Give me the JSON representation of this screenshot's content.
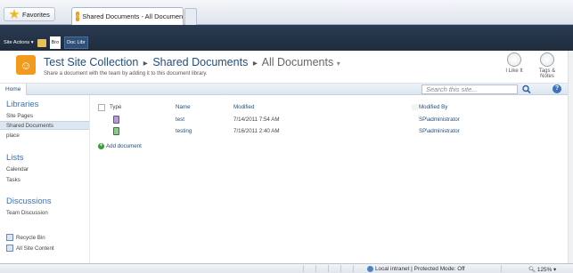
{
  "browser": {
    "favorites_label": "Favorites",
    "tab_title": "Shared Documents - All Documents"
  },
  "ribbon": {
    "site_actions": "Site Actions ▾",
    "browse_tab": "Bro",
    "library_tab": "Doc Libr"
  },
  "title_area": {
    "site_name": "Test Site Collection",
    "list_name": "Shared Documents",
    "view_name": "All Documents",
    "view_dropdown": "▾",
    "description": "Share a document with the team by adding it to this document library.",
    "i_like_it": "I Like It",
    "tags_notes": "Tags & Notes"
  },
  "topnav": {
    "home": "Home",
    "search_placeholder": "Search this site...",
    "help": "?"
  },
  "leftnav": {
    "libraries_heading": "Libraries",
    "libraries": [
      "Site Pages",
      "Shared Documents",
      "place"
    ],
    "lists_heading": "Lists",
    "lists": [
      "Calendar",
      "Tasks"
    ],
    "discussions_heading": "Discussions",
    "discussions": [
      "Team Discussion"
    ],
    "recycle_bin": "Recycle Bin",
    "all_site_content": "All Site Content"
  },
  "list": {
    "columns": [
      "Type",
      "Name",
      "Modified",
      "Modified By"
    ],
    "rows": [
      {
        "name": "test",
        "modified": "7/14/2011 7:54 AM",
        "modified_by": "SP\\administrator",
        "icon": "onenote-icon"
      },
      {
        "name": "testing",
        "modified": "7/16/2011 2:40 AM",
        "modified_by": "SP\\administrator",
        "icon": "excel-icon"
      }
    ],
    "add_document": "Add document"
  },
  "status": {
    "zone": "Local intranet | Protected Mode: Off",
    "zoom": "125%"
  },
  "colors": {
    "ribbon_bg": "#1f2c3d",
    "link": "#234e81",
    "heading": "#3c72b8",
    "site_icon": "#f39a1d"
  }
}
